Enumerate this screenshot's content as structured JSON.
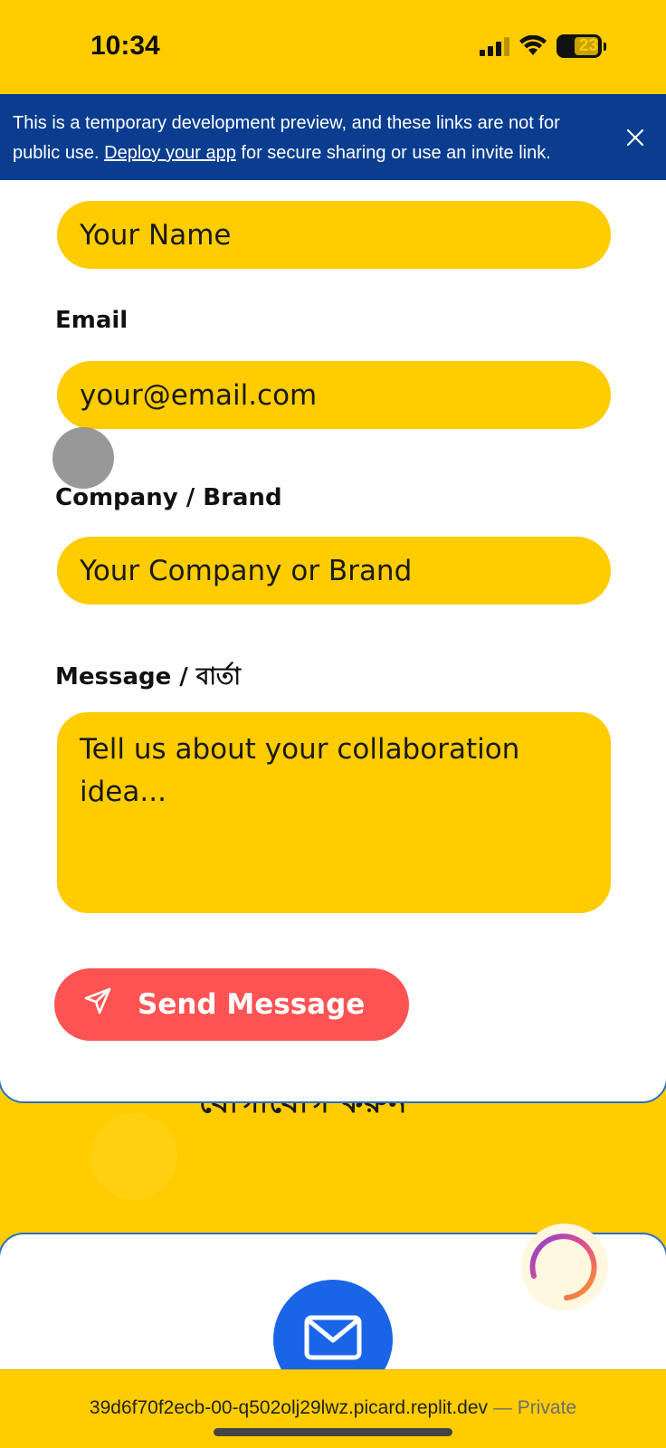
{
  "status_bar": {
    "time": "10:34",
    "battery": "23"
  },
  "dev_banner": {
    "text_before": "This is a temporary development preview, and these links are not for public use. ",
    "link": "Deploy your app",
    "text_after": " for secure sharing or use an invite link."
  },
  "form": {
    "name_placeholder": "Your Name",
    "email_label": "Email",
    "email_placeholder": "your@email.com",
    "company_label": "Company / Brand",
    "company_placeholder": "Your Company or Brand",
    "message_label": "Message / বার্তা",
    "message_placeholder": "Tell us about your collaboration idea...",
    "send_label": "Send Message"
  },
  "background": {
    "heading": "যোগাযোগ করুন"
  },
  "url_bar": {
    "url": "39d6f70f2ecb-00-q502olj29lwz.picard.replit.dev",
    "separator": " — ",
    "private": "Private"
  },
  "colors": {
    "primary_yellow": "#ffcc00",
    "banner_blue": "#0a3d8f",
    "send_red": "#ff5252",
    "mail_blue": "#1a64e8"
  }
}
